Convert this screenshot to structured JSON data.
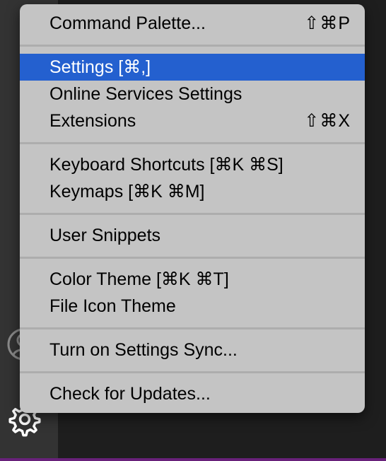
{
  "menu": {
    "command_palette": {
      "label": "Command Palette...",
      "shortcut": "⇧⌘P"
    },
    "settings": {
      "label": "Settings [⌘,]"
    },
    "online_services": {
      "label": "Online Services Settings"
    },
    "extensions": {
      "label": "Extensions",
      "shortcut": "⇧⌘X"
    },
    "keyboard_shortcuts": {
      "label": "Keyboard Shortcuts [⌘K ⌘S]"
    },
    "keymaps": {
      "label": "Keymaps [⌘K ⌘M]"
    },
    "user_snippets": {
      "label": "User Snippets"
    },
    "color_theme": {
      "label": "Color Theme [⌘K ⌘T]"
    },
    "file_icon_theme": {
      "label": "File Icon Theme"
    },
    "settings_sync": {
      "label": "Turn on Settings Sync..."
    },
    "check_updates": {
      "label": "Check for Updates..."
    }
  },
  "icons": {
    "account": "account-icon",
    "manage": "gear-icon"
  },
  "colors": {
    "menu_background": "#c4c4c4",
    "selection": "#2460cf",
    "activity_bar": "#333333",
    "editor": "#1e1e1e",
    "status_bar": "#68217a"
  }
}
